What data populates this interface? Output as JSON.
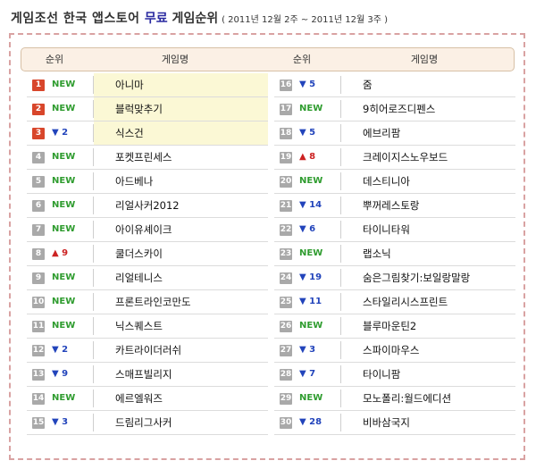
{
  "title": {
    "part1": "게임조선 한국 앱스토어 ",
    "part2": "무료",
    "part3": " 게임순위",
    "period": "( 2011년 12월 2주 ~ 2011년 12월 3주 )"
  },
  "header": {
    "rank_label": "순위",
    "name_label": "게임명"
  },
  "colors": {
    "new": "#2f9c2f",
    "down": "#2244bb",
    "up": "#cc2222",
    "top_rank_badge": "#d8462b",
    "rank_badge": "#a9a9a9",
    "highlight_row": "#fbf8d5",
    "border_dashed": "#d9a2a2"
  },
  "left": [
    {
      "rank": "1",
      "change": "NEW",
      "name": "아니마"
    },
    {
      "rank": "2",
      "change": "NEW",
      "name": "블럭맞추기"
    },
    {
      "rank": "3",
      "change": "▼ 2",
      "name": "식스건"
    },
    {
      "rank": "4",
      "change": "NEW",
      "name": "포켓프린세스"
    },
    {
      "rank": "5",
      "change": "NEW",
      "name": "아드베나"
    },
    {
      "rank": "6",
      "change": "NEW",
      "name": "리얼사커2012"
    },
    {
      "rank": "7",
      "change": "NEW",
      "name": "아이유셰이크"
    },
    {
      "rank": "8",
      "change": "▲ 9",
      "name": "쿨더스카이"
    },
    {
      "rank": "9",
      "change": "NEW",
      "name": "리얼테니스"
    },
    {
      "rank": "10",
      "change": "NEW",
      "name": "프론트라인코만도"
    },
    {
      "rank": "11",
      "change": "NEW",
      "name": "닉스퀘스트"
    },
    {
      "rank": "12",
      "change": "▼ 2",
      "name": "카트라이더러쉬"
    },
    {
      "rank": "13",
      "change": "▼ 9",
      "name": "스매프빌리지"
    },
    {
      "rank": "14",
      "change": "NEW",
      "name": "에르엘워즈"
    },
    {
      "rank": "15",
      "change": "▼ 3",
      "name": "드림리그사커"
    }
  ],
  "right": [
    {
      "rank": "16",
      "change": "▼ 5",
      "name": "줌"
    },
    {
      "rank": "17",
      "change": "NEW",
      "name": "9히어로즈디펜스"
    },
    {
      "rank": "18",
      "change": "▼ 5",
      "name": "에브리팜"
    },
    {
      "rank": "19",
      "change": "▲ 8",
      "name": "크레이지스노우보드"
    },
    {
      "rank": "20",
      "change": "NEW",
      "name": "데스티니아"
    },
    {
      "rank": "21",
      "change": "▼ 14",
      "name": "뿌꺼레스토랑"
    },
    {
      "rank": "22",
      "change": "▼ 6",
      "name": "타이니타워"
    },
    {
      "rank": "23",
      "change": "NEW",
      "name": "랩소닉"
    },
    {
      "rank": "24",
      "change": "▼ 19",
      "name": "숨은그림찾기:보일랑말랑"
    },
    {
      "rank": "25",
      "change": "▼ 11",
      "name": "스타일리시스프린트"
    },
    {
      "rank": "26",
      "change": "NEW",
      "name": "블루마운틴2"
    },
    {
      "rank": "27",
      "change": "▼ 3",
      "name": "스파이마우스"
    },
    {
      "rank": "28",
      "change": "▼ 7",
      "name": "타이니팜"
    },
    {
      "rank": "29",
      "change": "NEW",
      "name": "모노폴리:월드에디션"
    },
    {
      "rank": "30",
      "change": "▼ 28",
      "name": "비바삼국지"
    }
  ]
}
